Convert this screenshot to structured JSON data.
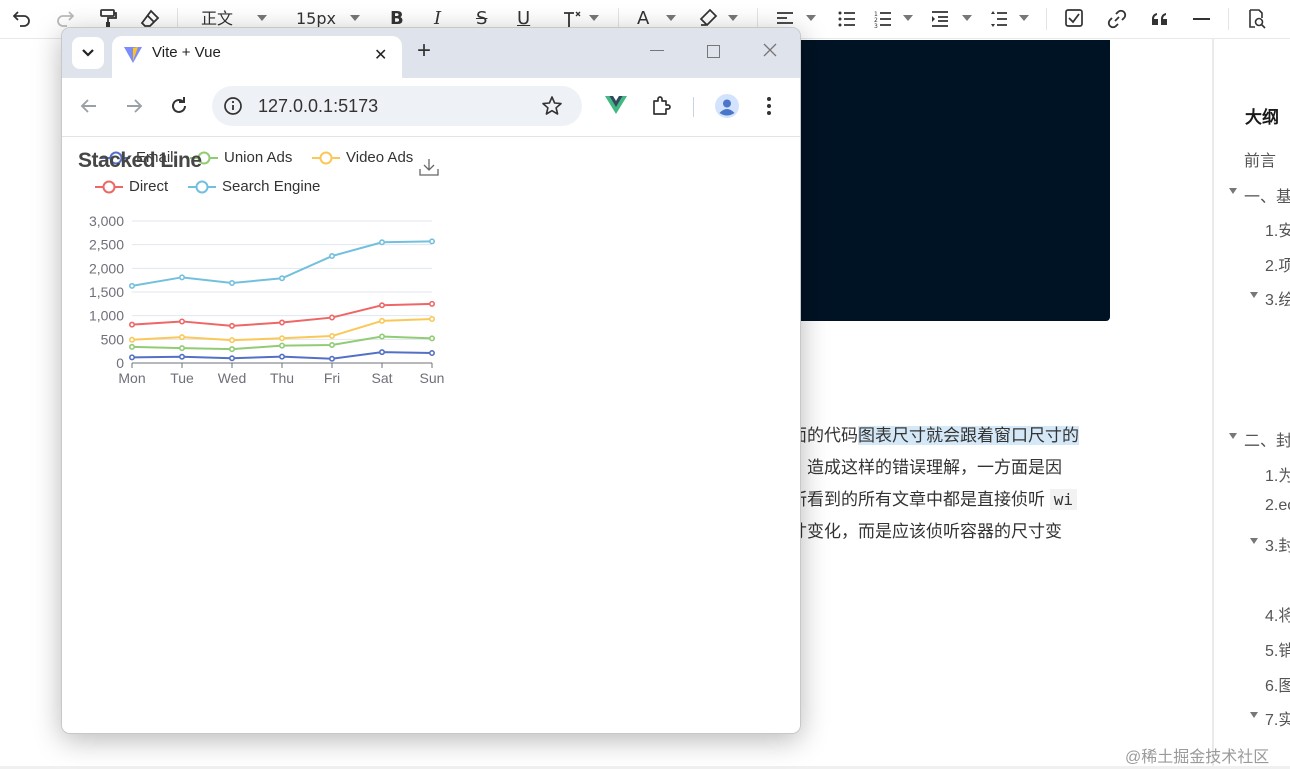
{
  "toolbar": {
    "undo_icon": "undo-icon",
    "paragraph_style": "正文",
    "font_size": "15px",
    "bold": "B",
    "italic": "I",
    "strike": "S",
    "underline": "U",
    "font_color": "A"
  },
  "outline": {
    "title": "大纲",
    "items": [
      "前言",
      "一、基",
      "1.安",
      "2.项",
      "3.绘",
      "二、封",
      "1.为",
      "2.ec",
      "3.封",
      "4.将",
      "5.销",
      "6.图",
      "7.实"
    ]
  },
  "article": {
    "line1_prefix": "面的代码",
    "line1_highlight": "图表尺寸就会跟着窗口尺寸的",
    "line2": "。造成这样的错误理解，一方面是因",
    "line3": "所看到的所有文章中都是直接侦听",
    "line3_code": "wi",
    "line4": "寸变化，而是应该侦听容器的尺寸变"
  },
  "watermark": "@稀土掘金技术社区",
  "browser": {
    "tab_title": "Vite + Vue",
    "tab_close": "✕",
    "new_tab": "+",
    "url": "127.0.0.1:5173"
  },
  "chart_data": {
    "type": "line",
    "title": "Stacked Line",
    "categories": [
      "Mon",
      "Tue",
      "Wed",
      "Thu",
      "Fri",
      "Sat",
      "Sun"
    ],
    "ylim": [
      0,
      3000
    ],
    "yticks": [
      "0",
      "500",
      "1,000",
      "1,500",
      "2,000",
      "2,500",
      "3,000"
    ],
    "legend_position": "top",
    "series": [
      {
        "name": "Email",
        "color": "#5470c6",
        "values": [
          120,
          132,
          101,
          134,
          90,
          230,
          210
        ]
      },
      {
        "name": "Union Ads",
        "color": "#91cc75",
        "values": [
          340,
          314,
          292,
          368,
          380,
          560,
          520
        ]
      },
      {
        "name": "Video Ads",
        "color": "#fac858",
        "values": [
          490,
          546,
          482,
          522,
          570,
          890,
          930
        ]
      },
      {
        "name": "Direct",
        "color": "#ee6666",
        "values": [
          810,
          878,
          784,
          856,
          960,
          1220,
          1250
        ]
      },
      {
        "name": "Search Engine",
        "color": "#73c0de",
        "values": [
          1630,
          1810,
          1690,
          1790,
          2260,
          2550,
          2570
        ]
      }
    ]
  }
}
